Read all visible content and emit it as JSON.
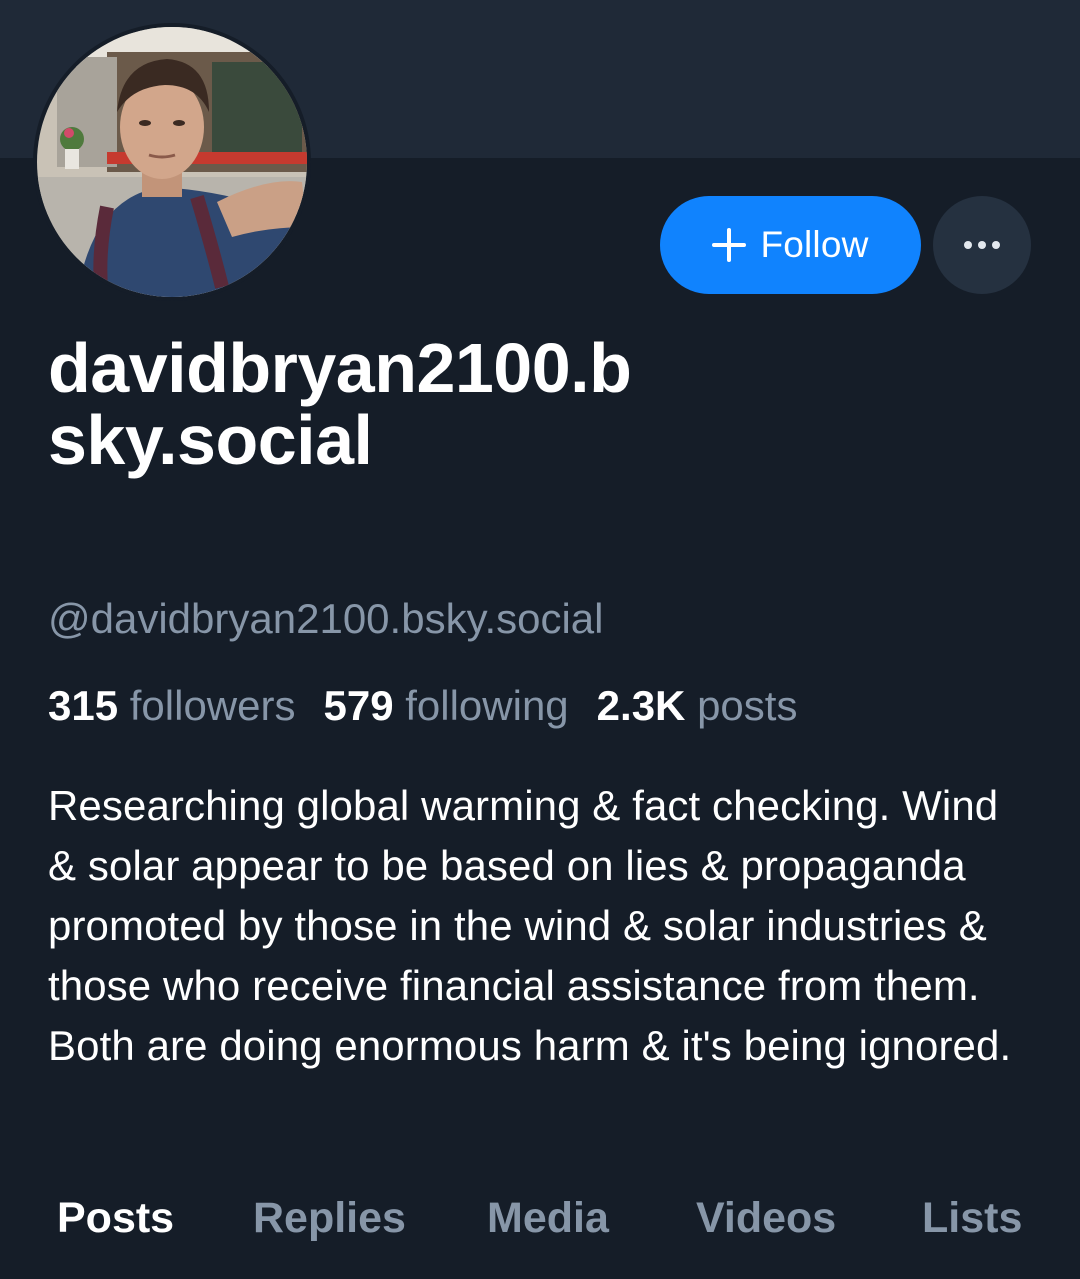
{
  "profile": {
    "display_name": "davidbryan2100.bsky.social",
    "handle": "@davidbryan2100.bsky.social",
    "follow_label": "Follow",
    "bio": "Researching global warming & fact checking. Wind & solar appear to be based on lies & propaganda promoted by those in the wind & solar industries & those who receive financial assistance from them. Both are doing enormous harm & it's being ignored."
  },
  "stats": [
    {
      "value": "315",
      "label": "followers"
    },
    {
      "value": "579",
      "label": "following"
    },
    {
      "value": "2.3K",
      "label": "posts"
    }
  ],
  "tabs": [
    {
      "label": "Posts",
      "active": true
    },
    {
      "label": "Replies",
      "active": false
    },
    {
      "label": "Media",
      "active": false
    },
    {
      "label": "Videos",
      "active": false
    },
    {
      "label": "Lists",
      "active": false
    }
  ],
  "icons": {
    "follow": "plus-icon",
    "more": "ellipsis-icon"
  },
  "colors": {
    "background": "#151d28",
    "banner": "#1f2937",
    "accent": "#1083fe",
    "muted_text": "#8796a8"
  }
}
